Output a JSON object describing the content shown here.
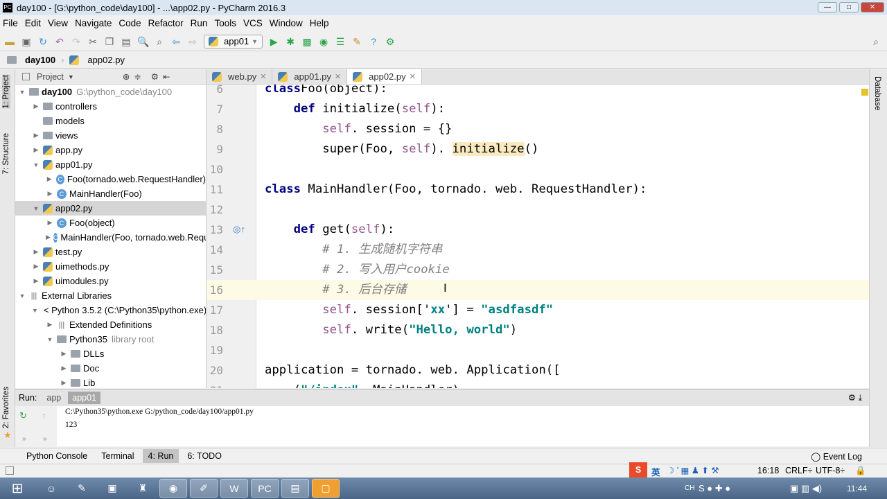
{
  "window": {
    "title": "day100 - [G:\\python_code\\day100] - ...\\app02.py - PyCharm 2016.3",
    "logo": "PC"
  },
  "menu": [
    "File",
    "Edit",
    "View",
    "Navigate",
    "Code",
    "Refactor",
    "Run",
    "Tools",
    "VCS",
    "Window",
    "Help"
  ],
  "toolbar": {
    "run_config": "app01"
  },
  "breadcrumb": [
    "day100",
    "app02.py"
  ],
  "left_strip": {
    "project": "1: Project",
    "structure": "7: Structure",
    "favorites": "2: Favorites"
  },
  "right_strip": {
    "database": "Database"
  },
  "project": {
    "header": "Project",
    "tree": [
      {
        "label": "day100",
        "extra": "G:\\python_code\\day100",
        "icon": "folder",
        "depth": 0,
        "expanded": true,
        "bold": true
      },
      {
        "label": "controllers",
        "icon": "folder",
        "depth": 1,
        "expanded": false
      },
      {
        "label": "models",
        "icon": "folder",
        "depth": 1,
        "expanded": null
      },
      {
        "label": "views",
        "icon": "folder",
        "depth": 1,
        "expanded": false
      },
      {
        "label": "app.py",
        "icon": "python-file",
        "depth": 1,
        "expanded": false
      },
      {
        "label": "app01.py",
        "icon": "python-file",
        "depth": 1,
        "expanded": true
      },
      {
        "label": "Foo(tornado.web.RequestHandler)",
        "icon": "class",
        "depth": 2,
        "expanded": false
      },
      {
        "label": "MainHandler(Foo)",
        "icon": "class",
        "depth": 2,
        "expanded": false
      },
      {
        "label": "app02.py",
        "icon": "python-file",
        "depth": 1,
        "expanded": true,
        "selected": true
      },
      {
        "label": "Foo(object)",
        "icon": "class",
        "depth": 2,
        "expanded": false
      },
      {
        "label": "MainHandler(Foo, tornado.web.RequestHandler)",
        "icon": "class",
        "depth": 2,
        "expanded": false
      },
      {
        "label": "test.py",
        "icon": "python-file",
        "depth": 1,
        "expanded": false
      },
      {
        "label": "uimethods.py",
        "icon": "python-file",
        "depth": 1,
        "expanded": false
      },
      {
        "label": "uimodules.py",
        "icon": "python-file",
        "depth": 1,
        "expanded": false
      },
      {
        "label": "External Libraries",
        "icon": "library",
        "depth": 0,
        "expanded": true
      },
      {
        "label": "< Python 3.5.2 (C:\\Python35\\python.exe) >",
        "icon": "python-sdk",
        "depth": 1,
        "expanded": true
      },
      {
        "label": "Extended Definitions",
        "icon": "library",
        "depth": 2,
        "expanded": false
      },
      {
        "label": "Python35",
        "extra": "library root",
        "icon": "folder",
        "depth": 2,
        "expanded": true
      },
      {
        "label": "DLLs",
        "icon": "folder",
        "depth": 3,
        "expanded": false
      },
      {
        "label": "Doc",
        "icon": "folder",
        "depth": 3,
        "expanded": false
      },
      {
        "label": "Lib",
        "icon": "folder",
        "depth": 3,
        "expanded": false
      }
    ]
  },
  "editor_tabs": [
    {
      "label": "web.py"
    },
    {
      "label": "app01.py"
    },
    {
      "label": "app02.py",
      "active": true
    }
  ],
  "code": [
    {
      "n": "6",
      "t": [
        [
          "kw",
          "class"
        ],
        [
          "",
          "Foo(object):"
        ]
      ]
    },
    {
      "n": "7",
      "t": [
        [
          "",
          "    "
        ],
        [
          "kw",
          "def"
        ],
        [
          "",
          " initialize("
        ],
        [
          "self",
          "self"
        ],
        [
          "",
          "):"
        ]
      ]
    },
    {
      "n": "8",
      "t": [
        [
          "",
          "        "
        ],
        [
          "self",
          "self"
        ],
        [
          "",
          ". session = {}"
        ]
      ]
    },
    {
      "n": "9",
      "t": [
        [
          "",
          "        super(Foo, "
        ],
        [
          "self",
          "self"
        ],
        [
          "",
          "). "
        ],
        [
          "hl",
          "initialize"
        ],
        [
          "",
          "()"
        ]
      ]
    },
    {
      "n": "10",
      "t": []
    },
    {
      "n": "11",
      "t": [
        [
          "kw",
          "class"
        ],
        [
          "",
          " MainHandler(Foo, tornado. web. RequestHandler):"
        ]
      ]
    },
    {
      "n": "12",
      "t": []
    },
    {
      "n": "13",
      "t": [
        [
          "",
          "    "
        ],
        [
          "kw",
          "def"
        ],
        [
          "",
          " get("
        ],
        [
          "self",
          "self"
        ],
        [
          "",
          "):"
        ]
      ]
    },
    {
      "n": "14",
      "t": [
        [
          "",
          "        "
        ],
        [
          "cmt",
          "# 1. 生成随机字符串"
        ]
      ]
    },
    {
      "n": "15",
      "t": [
        [
          "",
          "        "
        ],
        [
          "cmt",
          "# 2. 写入用户cookie"
        ]
      ]
    },
    {
      "n": "16",
      "t": [
        [
          "",
          "        "
        ],
        [
          "cmt",
          "# 3. 后台存储"
        ]
      ],
      "current": true
    },
    {
      "n": "17",
      "t": [
        [
          "",
          "        "
        ],
        [
          "self",
          "self"
        ],
        [
          "",
          ". session['"
        ],
        [
          "str",
          "xx"
        ],
        [
          "",
          "'] = "
        ],
        [
          "str",
          "\"asdfasdf\""
        ]
      ]
    },
    {
      "n": "18",
      "t": [
        [
          "",
          "        "
        ],
        [
          "self",
          "self"
        ],
        [
          "",
          ". write("
        ],
        [
          "str",
          "\"Hello, world\""
        ],
        [
          "",
          ")"
        ]
      ]
    },
    {
      "n": "19",
      "t": []
    },
    {
      "n": "20",
      "t": [
        [
          "",
          "application = tornado. web. Application(["
        ]
      ]
    },
    {
      "n": "21",
      "t": [
        [
          "",
          "    ("
        ],
        [
          "str",
          "\"/index\""
        ],
        [
          "",
          ", MainHandler),"
        ]
      ]
    }
  ],
  "run": {
    "label": "Run:",
    "tabs": [
      {
        "label": "app"
      },
      {
        "label": "app01",
        "active": true
      }
    ],
    "output": [
      "C:\\Python35\\python.exe G:/python_code/day100/app01.py",
      "123"
    ]
  },
  "bottom_tabs": [
    {
      "label": "Python Console"
    },
    {
      "label": "Terminal"
    },
    {
      "label": "4: Run",
      "active": true
    },
    {
      "label": "6: TODO"
    }
  ],
  "event_log": "Event Log",
  "status": {
    "position": "16:18",
    "line_sep": "CRLF",
    "encoding": "UTF-8",
    "ime": "英"
  },
  "taskbar": {
    "lang": "CH",
    "clock": "11:44"
  }
}
